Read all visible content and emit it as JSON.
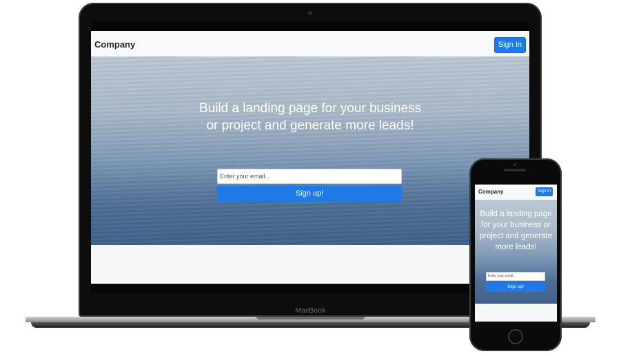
{
  "laptop": {
    "brand_label": "MacBook",
    "page": {
      "brand": "Company",
      "signin_label": "Sign In",
      "headline": "Build a landing page for your business or project and generate more leads!",
      "email_placeholder": "Enter your email...",
      "signup_label": "Sign up!"
    }
  },
  "phone": {
    "page": {
      "brand": "Company",
      "signin_label": "Sign In",
      "headline": "Build a landing page for your business or project and generate more leads!",
      "email_placeholder": "Enter your email...",
      "signup_label": "Sign up!"
    }
  },
  "colors": {
    "accent": "#1f7ae8",
    "navbar_bg": "#f8f9fa",
    "device_frame": "#0d0d0d"
  }
}
